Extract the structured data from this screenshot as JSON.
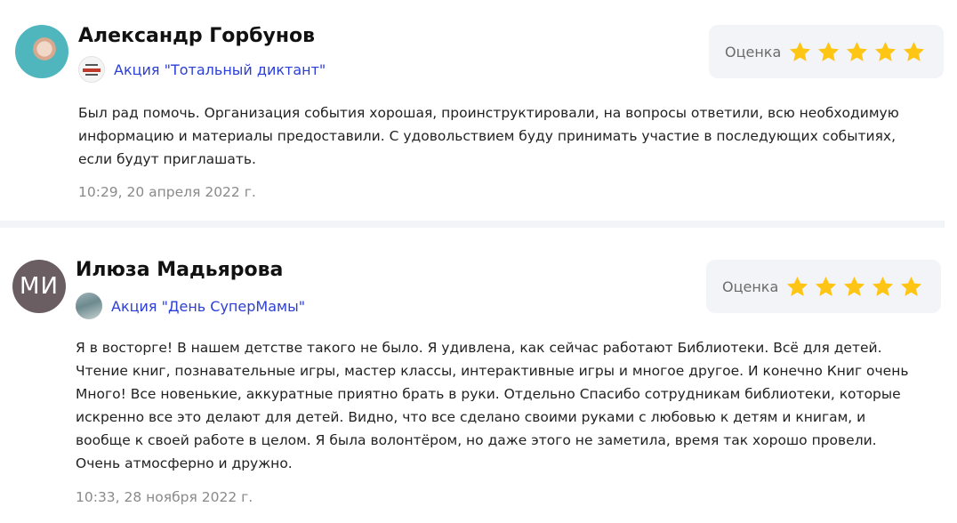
{
  "reviews": [
    {
      "author": "Александр Горбунов",
      "avatar_initials": "",
      "event_label": "Акция \"Тотальный диктант\"",
      "rating_label": "Оценка",
      "rating": 5,
      "text": "Был рад помочь. Организация события хорошая, проинструктировали, на вопросы ответили, всю необходимую\nинформацию и материалы предоставили. С удовольствием буду принимать участие в последующих событиях,\nесли будут приглашать.",
      "date": "10:29, 20 апреля 2022 г."
    },
    {
      "author": "Илюза Мадьярова",
      "avatar_initials": "МИ",
      "event_label": "Акция \"День СуперМамы\"",
      "rating_label": "Оценка",
      "rating": 5,
      "text": "Я в восторге! В нашем детстве такого не было. Я удивлена, как сейчас работают Библиотеки. Всё для детей.\nЧтение книг, познавательные игры, мастер классы, интерактивные игры и многое другое. И конечно Книг очень\nМного! Все новенькие, аккуратные приятно брать в руки. Отдельно Спасибо сотрудникам библиотеки, которые\nискренно все это делают для детей. Видно, что все сделано своими руками с любовью к детям и книгам, и\nвообще к своей работе в целом. Я была волонтёром, но даже этого не заметила, время так хорошо провели.\nОчень атмосферно и дружно.",
      "date": "10:33, 28 ноября 2022 г."
    }
  ],
  "colors": {
    "star": "#ffc515",
    "link": "#2b3fd6",
    "rating_bg": "#f3f4f7",
    "date": "#8a8a8a"
  },
  "icons": {
    "star": "star-icon"
  }
}
